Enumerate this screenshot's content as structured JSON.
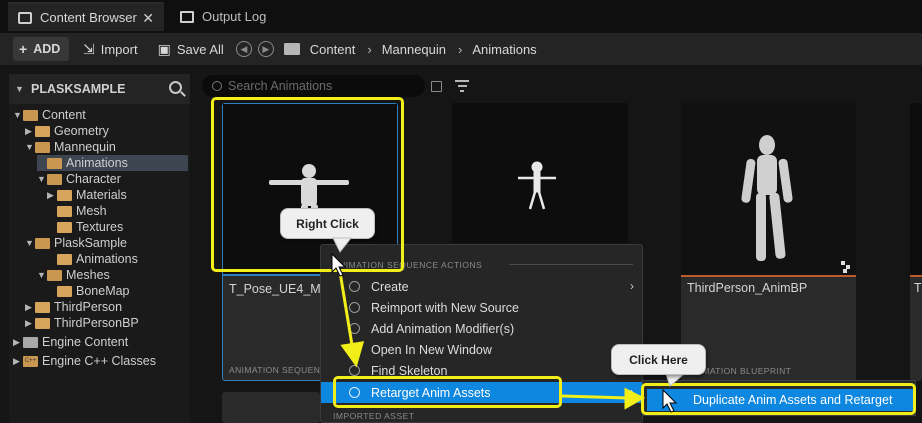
{
  "tabs": [
    {
      "label": "Content Browser",
      "active": true,
      "close": "✕"
    },
    {
      "label": "Output Log",
      "active": false
    }
  ],
  "toolbar": {
    "add_label": "ADD",
    "import_label": "Import",
    "save_all_label": "Save All",
    "breadcrumbs": [
      "Content",
      "Mannequin",
      "Animations"
    ],
    "separator": "›"
  },
  "sidebar": {
    "title": "PLASKSAMPLE",
    "items": [
      {
        "label": "Content",
        "level": 0,
        "expanded": true
      },
      {
        "label": "Geometry",
        "level": 1,
        "expanded": false
      },
      {
        "label": "Mannequin",
        "level": 1,
        "expanded": true
      },
      {
        "label": "Animations",
        "level": 2,
        "selected": true
      },
      {
        "label": "Character",
        "level": 2,
        "expanded": true
      },
      {
        "label": "Materials",
        "level": 3,
        "expanded": false
      },
      {
        "label": "Mesh",
        "level": 3
      },
      {
        "label": "Textures",
        "level": 3
      },
      {
        "label": "PlaskSample",
        "level": 1,
        "expanded": true
      },
      {
        "label": "Animations",
        "level": 2
      },
      {
        "label": "Meshes",
        "level": 2,
        "expanded": true
      },
      {
        "label": "BoneMap",
        "level": 3
      },
      {
        "label": "ThirdPerson",
        "level": 1,
        "expanded": false
      },
      {
        "label": "ThirdPersonBP",
        "level": 1,
        "expanded": false
      },
      {
        "label": "Engine Content",
        "level": 0,
        "expanded": false
      },
      {
        "label": "Engine C++ Classes",
        "level": 0,
        "expanded": false
      }
    ]
  },
  "search": {
    "placeholder": "Search Animations"
  },
  "assets": [
    {
      "title": "T_Pose_UE4_Man",
      "type": "ANIMATION SEQUENCE",
      "color": "#2f7fbf"
    },
    {
      "title": "",
      "type": "",
      "color": "#2f7fbf"
    },
    {
      "title": "ThirdPerson_AnimBP",
      "type": "ANIMATION BLUEPRINT",
      "color": "#c05a2a"
    },
    {
      "title": "T",
      "type": "",
      "color": "#c05a2a"
    }
  ],
  "context_menu": {
    "section1": "ANIMATION SEQUENCE ACTIONS",
    "items": [
      "Create",
      "Reimport with New Source",
      "Add Animation Modifier(s)",
      "Open In New Window",
      "Find Skeleton",
      "Retarget Anim Assets"
    ],
    "section2": "IMPORTED ASSET"
  },
  "submenu": {
    "item": "Duplicate Anim Assets and Retarget"
  },
  "annotations": {
    "callout_right_click": "Right Click",
    "callout_click_here": "Click Here",
    "highlight_color": "#f2ee1a"
  },
  "colors": {
    "accent": "#0d87e0",
    "folder": "#d6a45a"
  }
}
